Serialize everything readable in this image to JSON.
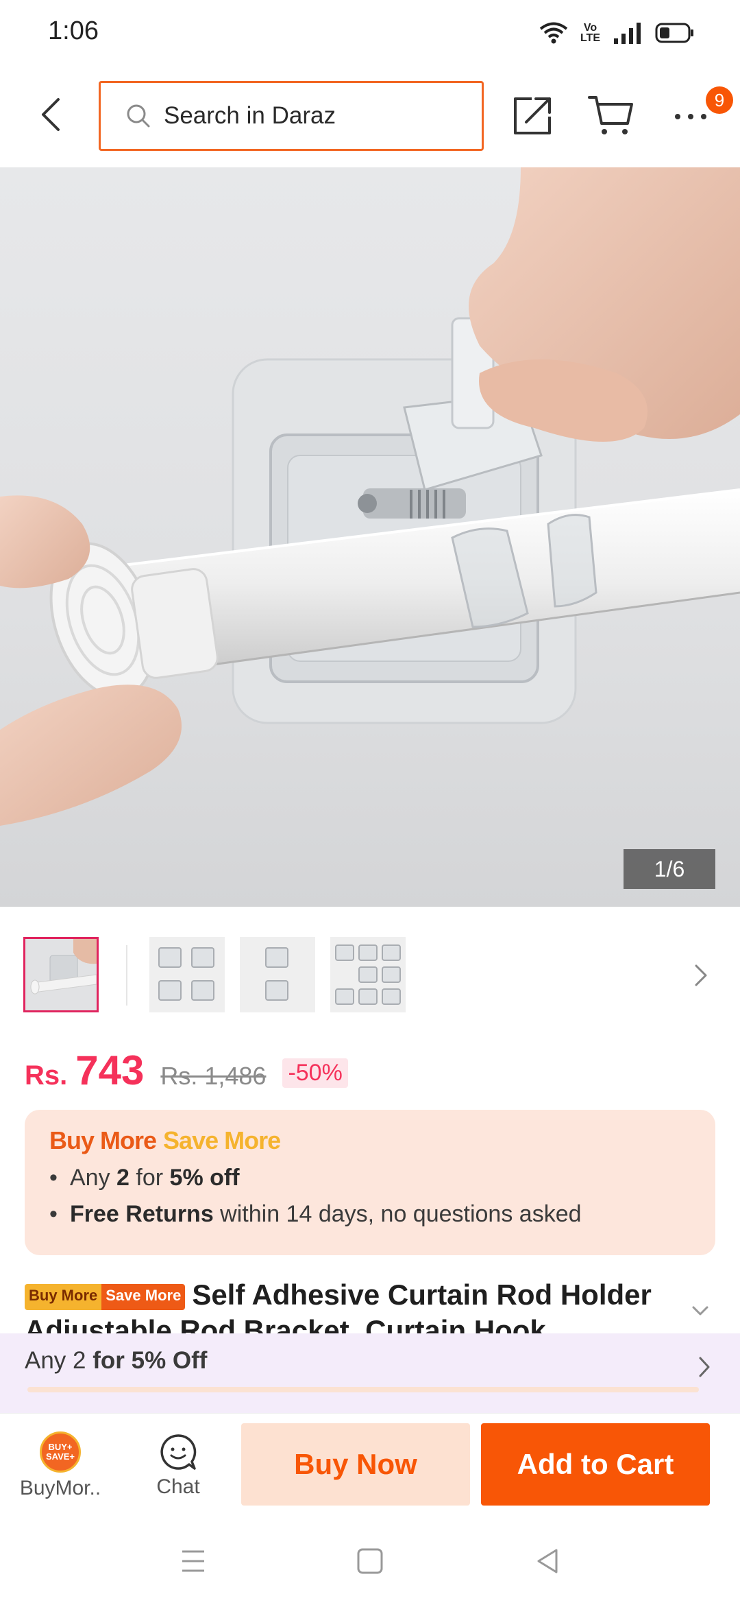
{
  "status_bar": {
    "time": "1:06",
    "volte_label": "Vo\nLTE"
  },
  "header": {
    "search_placeholder": "Search in Daraz",
    "cart_badge_count": "9"
  },
  "gallery": {
    "counter": "1/6",
    "thumbnail_count": 4
  },
  "price": {
    "currency": "Rs.",
    "current": "743",
    "original": "Rs. 1,486",
    "discount": "-50%"
  },
  "promo": {
    "title_part1": "Buy More",
    "title_part2": "Save More",
    "line1_prefix": "Any ",
    "line1_qty": "2",
    "line1_mid": " for ",
    "line1_offer": "5% off",
    "line2_bold": "Free Returns",
    "line2_rest": " within 14 days, no questions asked"
  },
  "product": {
    "tag_part1": "Buy More",
    "tag_part2": "Save More",
    "title": "Self Adhesive Curtain Rod Holder Adjustable Rod Bracket, Curtain Hook"
  },
  "sticky_promo": {
    "prefix": "Any 2 ",
    "bold": "for 5% Off"
  },
  "bottom_bar": {
    "buymore_label": "BuyMor..",
    "buymore_icon_text": "BUY+\nSAVE+",
    "chat_label": "Chat",
    "buy_now": "Buy Now",
    "add_to_cart": "Add to Cart"
  },
  "colors": {
    "brand_orange": "#f85606",
    "price_pink": "#f5315a",
    "promo_bg": "#fde6dc",
    "sticky_bg": "#f4ecfa"
  }
}
